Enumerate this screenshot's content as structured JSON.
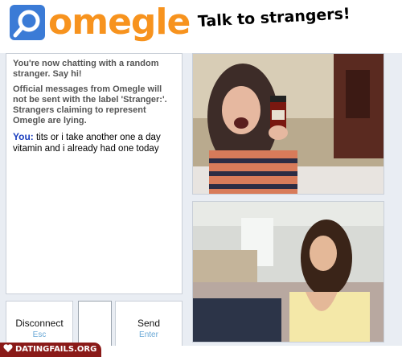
{
  "header": {
    "logo_text": "omegle",
    "tagline": "Talk to strangers!"
  },
  "chat": {
    "system_messages": [
      "You're now chatting with a random stranger. Say hi!",
      "Official messages from Omegle will not be sent with the label 'Stranger:'. Strangers claiming to represent Omegle are lying."
    ],
    "messages": [
      {
        "speaker": "You:",
        "text": "tits or i take another one a day vitamin and i already had one today"
      }
    ]
  },
  "controls": {
    "disconnect_label": "Disconnect",
    "disconnect_hint": "Esc",
    "send_label": "Send",
    "send_hint": "Enter",
    "message_input_value": ""
  },
  "watermark": {
    "text": "DATINGFAILS.ORG"
  },
  "colors": {
    "brand_orange": "#f7931e",
    "brand_blue": "#3b7bd6",
    "you_label": "#1c3fbf",
    "hint_blue": "#6aa8d6"
  },
  "icons": {
    "logo": "omegle-logo-icon",
    "watermark": "heart-icon"
  }
}
